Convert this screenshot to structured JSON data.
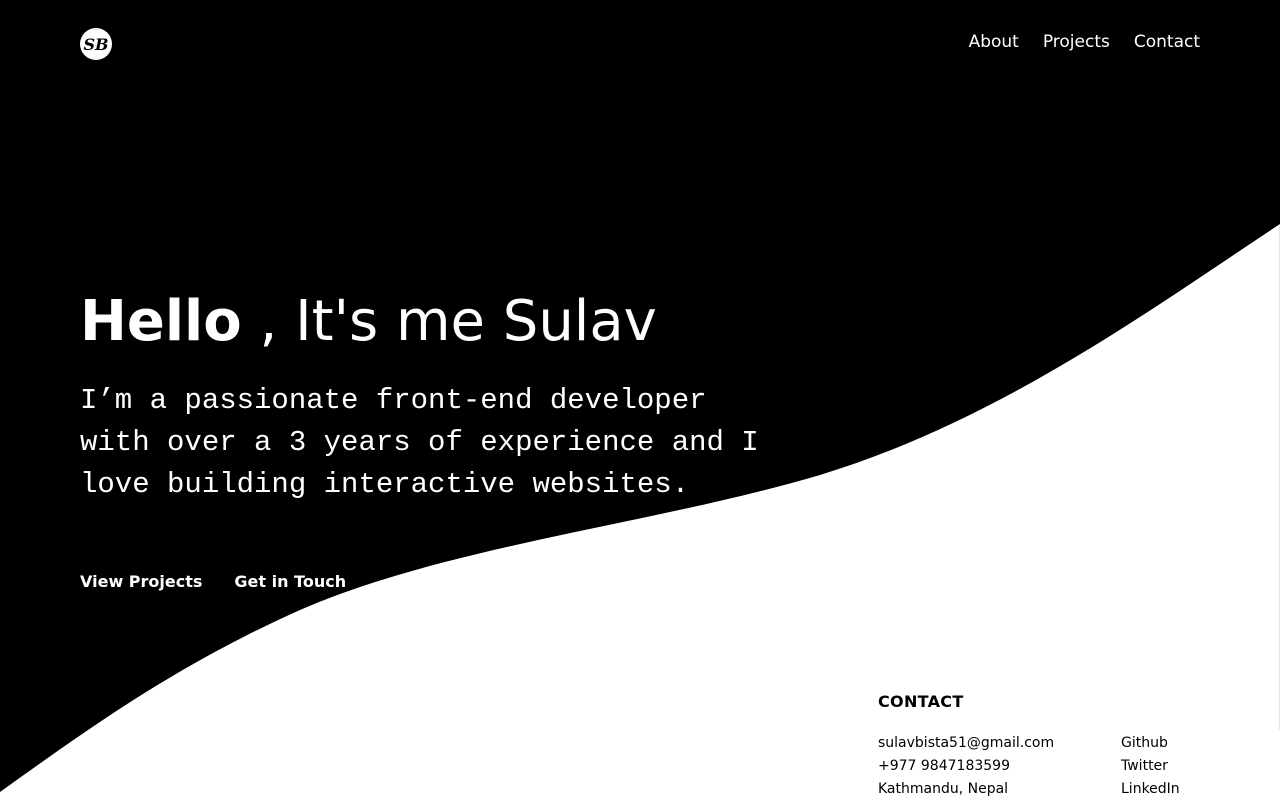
{
  "colors": {
    "background_dark": "#000000",
    "background_light": "#ffffff",
    "text_on_dark": "#ffffff",
    "text_on_light": "#000000"
  },
  "logo": {
    "text": "SB",
    "icon": "monogram-logo"
  },
  "nav": {
    "items": [
      {
        "label": "About"
      },
      {
        "label": "Projects"
      },
      {
        "label": "Contact"
      }
    ]
  },
  "hero": {
    "greeting_bold": "Hello",
    "greeting_rest": " , It's me Sulav",
    "description": "I’m a passionate front-end developer with over a 3 years of experience and I love building interactive websites.",
    "buttons": {
      "view_projects": "View Projects",
      "get_in_touch": "Get in Touch"
    }
  },
  "contact": {
    "heading": "CONTACT",
    "email": "sulavbista51@gmail.com",
    "phone": "+977 9847183599",
    "location": "Kathmandu, Nepal",
    "links": [
      {
        "label": "Github"
      },
      {
        "label": "Twitter"
      },
      {
        "label": "LinkedIn"
      }
    ]
  }
}
